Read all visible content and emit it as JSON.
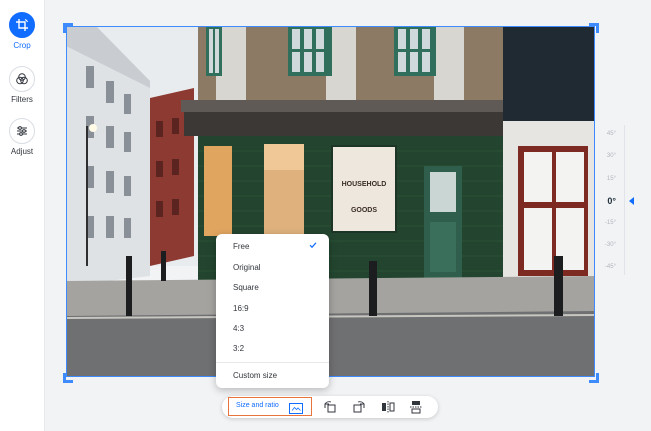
{
  "sidebar": {
    "items": [
      {
        "label": "Crop",
        "icon": "crop-rotate-icon",
        "active": true
      },
      {
        "label": "Filters",
        "icon": "filters-icon",
        "active": false
      },
      {
        "label": "Adjust",
        "icon": "sliders-icon",
        "active": false
      }
    ]
  },
  "photo": {
    "sign_line1": "HOUSEHOLD",
    "sign_line2": "GOODS"
  },
  "rotation": {
    "ticks": [
      "45°",
      "30°",
      "15°",
      "0°",
      "-15°",
      "-30°",
      "-45°"
    ],
    "current": "0°"
  },
  "ratio_menu": {
    "items": [
      "Free",
      "Original",
      "Square",
      "16:9",
      "4:3",
      "3:2"
    ],
    "selected": "Free",
    "custom_label": "Custom size"
  },
  "toolbar": {
    "size_ratio_label": "Size and ratio",
    "tools": [
      "rotate-left-icon",
      "rotate-right-icon",
      "flip-horizontal-icon",
      "flip-vertical-icon"
    ]
  },
  "colors": {
    "accent": "#116dff",
    "highlight": "#e8743b",
    "crop_frame": "#3d8bff"
  }
}
